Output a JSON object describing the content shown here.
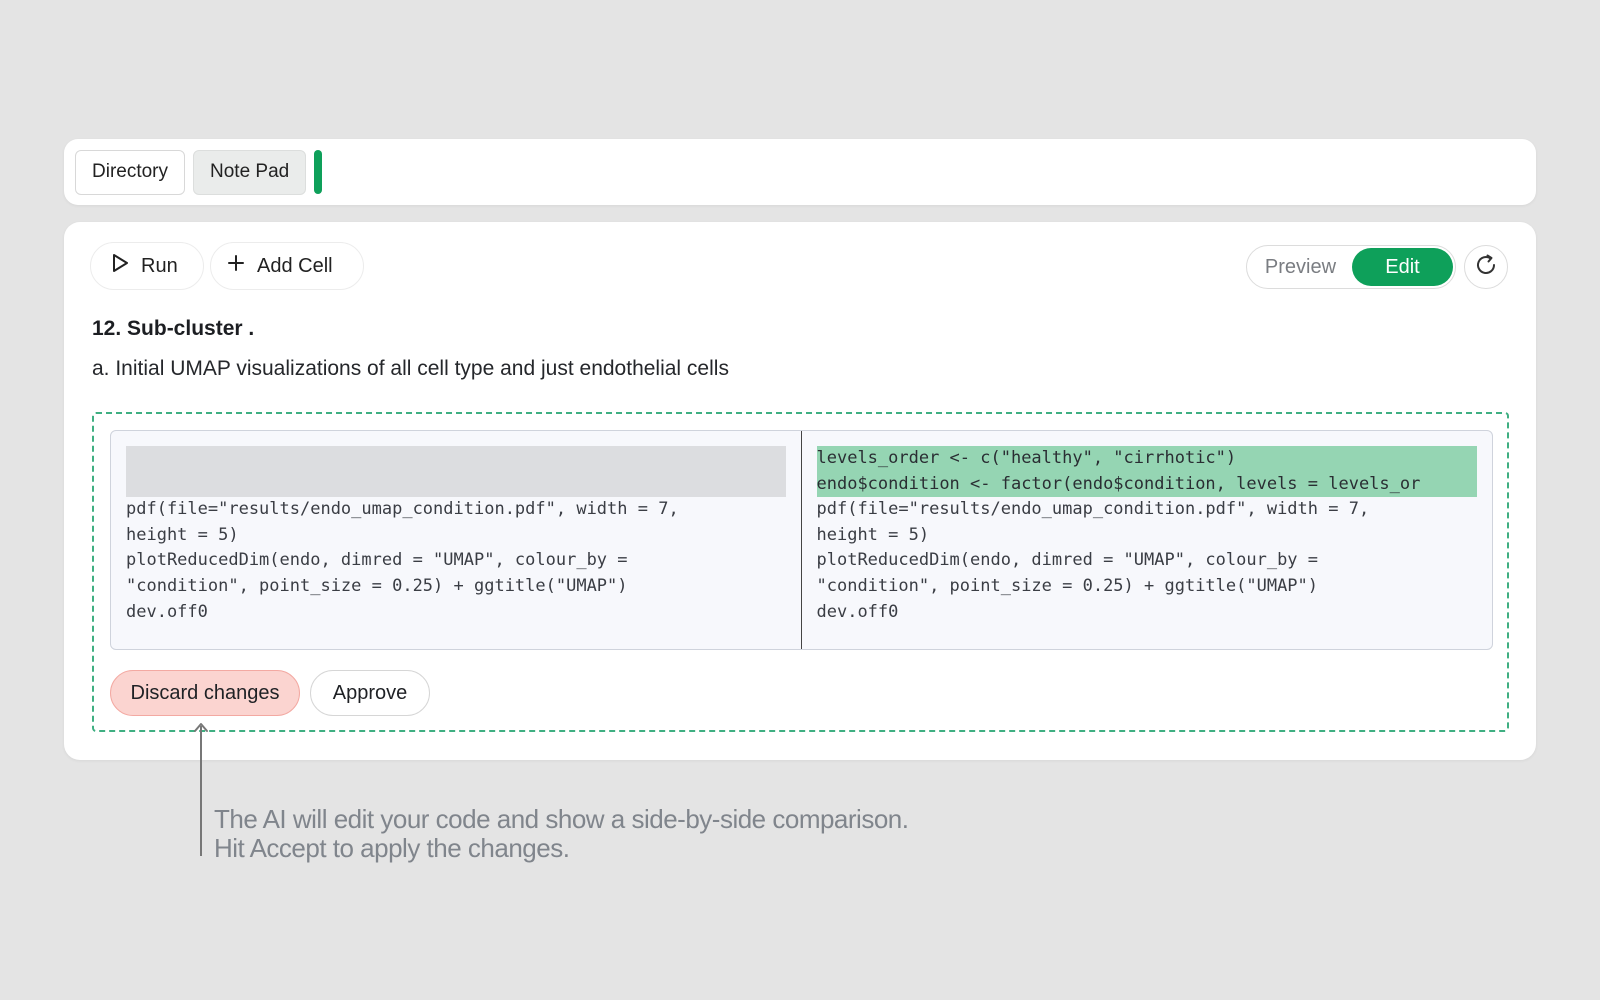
{
  "tabs": [
    {
      "label": "Directory"
    },
    {
      "label": "Note Pad"
    }
  ],
  "toolbar": {
    "run_label": "Run",
    "add_cell_label": "Add Cell",
    "preview_label": "Preview",
    "edit_label": "Edit",
    "active_mode": "Edit"
  },
  "cell": {
    "title": "12. Sub-cluster .",
    "description": "a. Initial UMAP visualizations of all cell type and just endothelial cells"
  },
  "diff": {
    "left_lines": [
      "",
      "",
      "pdf(file=\"results/endo_umap_condition.pdf\", width = 7,",
      "height = 5)",
      "plotReducedDim(endo, dimred = \"UMAP\", colour_by =",
      "\"condition\", point_size = 0.25) + ggtitle(\"UMAP\")",
      "dev.off0"
    ],
    "right_lines": [
      "levels_order <- c(\"healthy\", \"cirrhotic\")",
      "endo$condition <- factor(endo$condition, levels = levels_or",
      "pdf(file=\"results/endo_umap_condition.pdf\", width = 7,",
      "height = 5)",
      "plotReducedDim(endo, dimred = \"UMAP\", colour_by =",
      "\"condition\", point_size = 0.25) + ggtitle(\"UMAP\")",
      "dev.off0"
    ],
    "discard_label": "Discard changes",
    "approve_label": "Approve"
  },
  "annotation": {
    "line1": "The AI will edit your code and show a side-by-side comparison.",
    "line2": "Hit Accept to apply the changes."
  },
  "colors": {
    "accent": "#0ea05a",
    "added_line": "#95d5b3",
    "discard_bg": "#fbd4d0",
    "diff_border": "#3faf82"
  }
}
